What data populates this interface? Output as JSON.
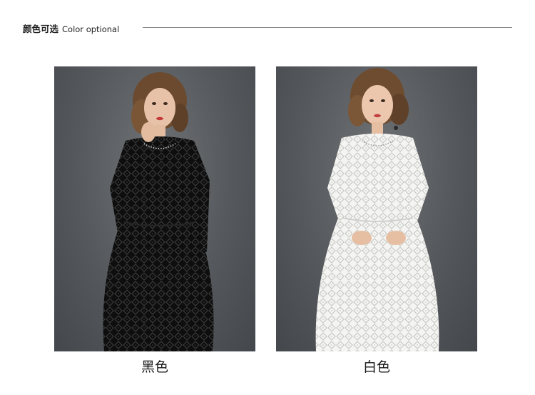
{
  "header": {
    "title_cn": "颜色可选",
    "title_en": "Color optional"
  },
  "variants": [
    {
      "label": "黑色",
      "dress_color": "#0e0e0e"
    },
    {
      "label": "白色",
      "dress_color": "#f4f4f2"
    }
  ]
}
